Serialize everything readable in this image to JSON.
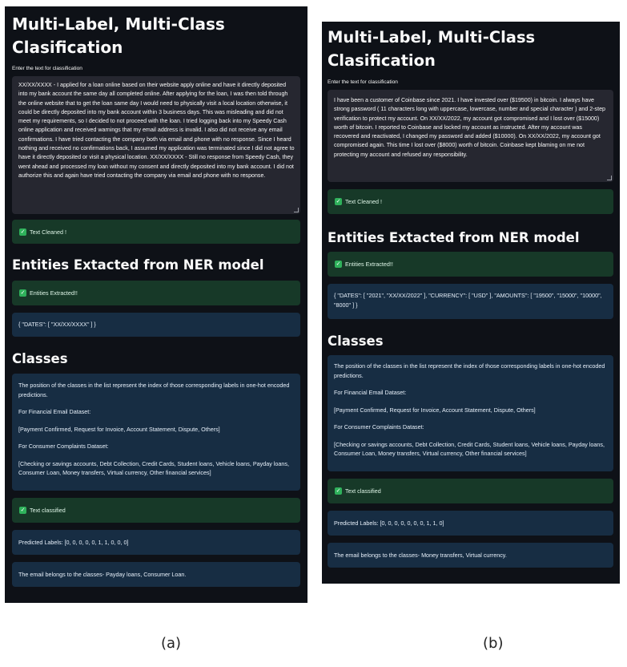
{
  "panel_a": {
    "title": "Multi-Label, Multi-Class Clasification",
    "input_label": "Enter the text for classification",
    "input_text": "XX/XX/XXXX - I applied for a loan online based on their website apply online and have it directly deposited into my bank account the same day all completed online. After applying for the loan, I was then told through the online website that to get the loan same day I would need to physically visit a local location otherwise, it could be directly deposited into my bank account within 3 business days. This was misleading and did not meet my requirements, so I decided to not proceed with the loan. I tried logging back into my Speedy Cash online application and received warnings that my email address is invalid. I also did not receive any email confirmations. I have tried contacting the company both via email and phone with no response. Since I heard nothing and received no confirmations back, I assumed my application was terminated since I did not agree to have it directly deposited or visit a physical location. XX/XX/XXXX - Still no response from Speedy Cash, they went ahead and processed my loan without my consent and directly deposited into my bank account. I did not authorize this and again have tried contacting the company via email and phone with no response.",
    "cleaned_msg": "Text Cleaned !",
    "ner_heading": "Entities Extacted from NER model",
    "entities_msg": "Entities Extracted!!",
    "entities_json": "{ \"DATES\": [ \"XX/XX/XXXX\" ] }",
    "classes_heading": "Classes",
    "classes_info": {
      "intro": "The position of the classes in the list represent the index of those corresponding labels in one-hot encoded predictions.",
      "financial_label": "For Financial Email Dataset:",
      "financial_list": "[Payment Confirmed, Request for Invoice, Account Statement, Dispute, Others]",
      "consumer_label": "For Consumer Complaints Dataset:",
      "consumer_list": "[Checking or savings accounts, Debt Collection, Credit Cards, Student loans, Vehicle loans, Payday loans, Consumer Loan, Money transfers, Virtual currency, Other financial services]"
    },
    "classified_msg": "Text classified",
    "predicted_labels": "Predicted Labels: [0, 0, 0, 0, 0, 1, 1, 0, 0, 0]",
    "result": "The email belongs to the classes- Payday loans, Consumer Loan."
  },
  "panel_b": {
    "title": "Multi-Label, Multi-Class Clasification",
    "input_label": "Enter the text for classification",
    "input_text": "I have been a customer of Coinbase since 2021. I have invested over ($19500) in bitcoin. I always have strong password ( 11 characters long with uppercase, lowercase, number and special character ) and 2-step verification to protect my account. On XX/XX/2022, my account got compromised and I lost over ($15000) worth of bitcoin. I reported to Coinbase and locked my account as instructed. After my account was recovered and reactivated, I changed my password and added ($10000). On XX/XX/2022, my account got compromised again. This time I lost over ($8000) worth of bitcoin. Coinbase kept blaming on me not protecting my account and refused any responsibility.",
    "cleaned_msg": "Text Cleaned !",
    "ner_heading": "Entities Extacted from NER model",
    "entities_msg": "Entities Extracted!!",
    "entities_json": "{ \"DATES\": [ \"2021\", \"XX/XX/2022\" ], \"CURRENCY\": [ \"USD\" ], \"AMOUNTS\": [ \"19500\", \"15000\", \"10000\", \"8000\" ] }",
    "classes_heading": "Classes",
    "classes_info": {
      "intro": "The position of the classes in the list represent the index of those corresponding labels in one-hot encoded predictions.",
      "financial_label": "For Financial Email Dataset:",
      "financial_list": "[Payment Confirmed, Request for Invoice, Account Statement, Dispute, Others]",
      "consumer_label": "For Consumer Complaints Dataset:",
      "consumer_list": "[Checking or savings accounts, Debt Collection, Credit Cards, Student loans, Vehicle loans, Payday loans, Consumer Loan, Money transfers, Virtual currency, Other financial services]"
    },
    "classified_msg": "Text classified",
    "predicted_labels": "Predicted Labels: [0, 0, 0, 0, 0, 0, 0, 1, 1, 0]",
    "result": "The email belongs to the classes- Money transfers, Virtual currency."
  },
  "captions": {
    "a": "(a)",
    "b": "(b)"
  },
  "colors": {
    "app_background": "#0e1117",
    "text_area": "#262730",
    "success_alert": "#173928",
    "info_alert": "#172d43",
    "check_icon": "#2fb15b"
  }
}
